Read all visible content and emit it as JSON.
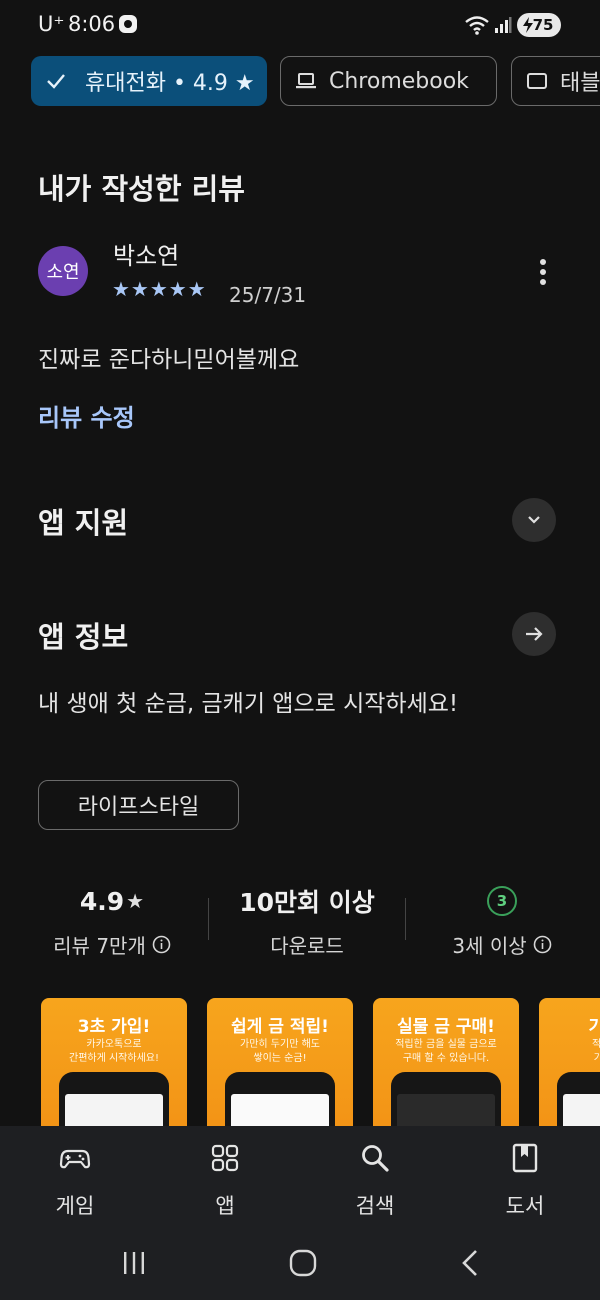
{
  "status_bar": {
    "carrier": "U⁺",
    "time": "8:06",
    "battery": "75"
  },
  "device_chips": [
    {
      "label": "휴대전화 • 4.9 ★",
      "icon": "check-icon",
      "selected": true
    },
    {
      "label": "Chromebook",
      "icon": "laptop-icon",
      "selected": false
    },
    {
      "label": "태블릿",
      "icon": "tablet-icon",
      "selected": false
    }
  ],
  "my_review": {
    "heading": "내가 작성한 리뷰",
    "avatar_text": "소연",
    "reviewer": "박소연",
    "stars": "★★★★★",
    "rating": 5,
    "date": "25/7/31",
    "text": "진짜로 준다하니믿어볼께요",
    "edit_label": "리뷰 수정"
  },
  "app_support": {
    "heading": "앱 지원"
  },
  "app_info": {
    "heading": "앱 정보",
    "description": "내 생애 첫 순금, 금캐기 앱으로 시작하세요!",
    "category": "라이프스타일"
  },
  "stats": {
    "rating_value": "4.9",
    "rating_star": "★",
    "reviews_label": "리뷰 7만개",
    "downloads_value": "10만회 이상",
    "downloads_label": "다운로드",
    "age_badge": "3",
    "age_label": "3세 이상"
  },
  "screenshots": [
    {
      "title": "3초 가입!",
      "subtitle_1": "카카오톡으로",
      "subtitle_2": "간편하게 시작하세요!"
    },
    {
      "title": "쉽게 금 적립!",
      "subtitle_1": "가만히 두기만 해도",
      "subtitle_2": "쌓이는 순금!"
    },
    {
      "title": "실물 금 구매!",
      "subtitle_1": "적립한 금을 실물 금으로",
      "subtitle_2": "구매 할 수 있습니다."
    },
    {
      "title": "기프티",
      "subtitle_1": "적립한 금",
      "subtitle_2": "기프티콘"
    }
  ],
  "bottom_nav": [
    {
      "label": "게임",
      "icon": "gamepad-icon"
    },
    {
      "label": "앱",
      "icon": "apps-grid-icon"
    },
    {
      "label": "검색",
      "icon": "search-icon"
    },
    {
      "label": "도서",
      "icon": "book-icon"
    }
  ],
  "colors": {
    "background": "#121212",
    "selected_chip": "#0b4f7a",
    "link": "#a8c7fa",
    "star": "#a9c7f5",
    "avatar": "#6b3fb0",
    "shot_orange": "#f7a51d"
  }
}
